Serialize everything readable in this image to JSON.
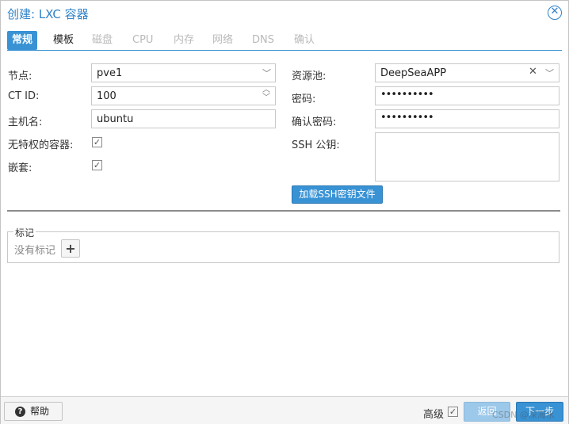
{
  "window": {
    "title": "创建: LXC 容器"
  },
  "tabs": [
    {
      "label": "常规"
    },
    {
      "label": "模板"
    },
    {
      "label": "磁盘"
    },
    {
      "label": "CPU"
    },
    {
      "label": "内存"
    },
    {
      "label": "网络"
    },
    {
      "label": "DNS"
    },
    {
      "label": "确认"
    }
  ],
  "left": {
    "node_label": "节点:",
    "node_value": "pve1",
    "ctid_label": "CT ID:",
    "ctid_value": "100",
    "hostname_label": "主机名:",
    "hostname_value": "ubuntu",
    "unprivileged_label": "无特权的容器:",
    "nesting_label": "嵌套:"
  },
  "right": {
    "pool_label": "资源池:",
    "pool_value": "DeepSeaAPP",
    "password_label": "密码:",
    "password_value": "••••••••••",
    "confirm_label": "确认密码:",
    "confirm_value": "••••••••••",
    "ssh_label": "SSH 公钥:",
    "load_ssh_button": "加载SSH密钥文件"
  },
  "tags": {
    "legend": "标记",
    "empty_text": "没有标记"
  },
  "footer": {
    "help": "帮助",
    "advanced": "高级",
    "back": "返回",
    "next": "下一步"
  },
  "watermark": "CSDN @深海水",
  "colors": {
    "accent": "#3892d4",
    "title": "#2f82c8"
  }
}
